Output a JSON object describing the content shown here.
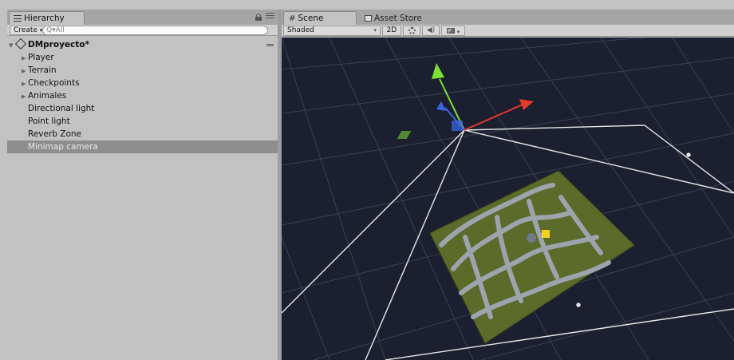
{
  "hierarchy": {
    "tab_label": "Hierarchy",
    "create_label": "Create",
    "search_placeholder": "Q▾All",
    "scene_name": "DMproyecto*",
    "items": [
      {
        "label": "Player",
        "has_children": true
      },
      {
        "label": "Terrain",
        "has_children": true
      },
      {
        "label": "Checkpoints",
        "has_children": true
      },
      {
        "label": "Animales",
        "has_children": true
      },
      {
        "label": "Directional light",
        "has_children": false
      },
      {
        "label": "Point light",
        "has_children": false
      },
      {
        "label": "Reverb Zone",
        "has_children": false
      },
      {
        "label": "Minimap camera",
        "has_children": false,
        "selected": true
      }
    ]
  },
  "scene": {
    "tabs": [
      {
        "label": "Scene",
        "active": true,
        "icon": "hash-icon"
      },
      {
        "label": "Asset Store",
        "active": false,
        "icon": "store-icon"
      }
    ],
    "toolbar": {
      "shading_mode": "Shaded",
      "btn_2d": "2D"
    }
  },
  "colors": {
    "viewport_bg": "#1b1f2f",
    "grid": "#3a4054",
    "gizmo_y": "#7ee234",
    "gizmo_x": "#e23a2a",
    "gizmo_z": "#3a66e2",
    "frustum": "#e8e8e8",
    "terrain_grass": "#5c6a2a",
    "terrain_path": "#9da4ad",
    "selected_row": "#8e8e8e"
  }
}
